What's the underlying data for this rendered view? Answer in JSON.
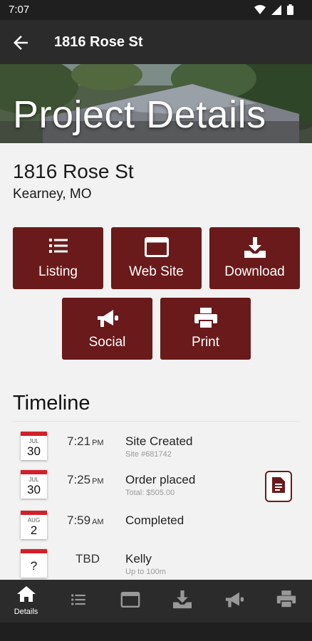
{
  "status_bar": {
    "time": "7:07"
  },
  "app_bar": {
    "title": "1816 Rose St",
    "back_icon": "arrow-back-icon"
  },
  "hero": {
    "title": "Project Details"
  },
  "address": {
    "street": "1816 Rose St",
    "city_state": "Kearney, MO"
  },
  "actions": [
    {
      "label": "Listing",
      "icon": "list-icon"
    },
    {
      "label": "Web Site",
      "icon": "browser-window-icon"
    },
    {
      "label": "Download",
      "icon": "download-icon"
    },
    {
      "label": "Social",
      "icon": "megaphone-icon"
    },
    {
      "label": "Print",
      "icon": "printer-icon"
    }
  ],
  "timeline": {
    "title": "Timeline",
    "events": [
      {
        "month": "JUL",
        "day": "30",
        "time": "7:21",
        "ampm": "PM",
        "event": "Site Created",
        "sub": "Site #681742"
      },
      {
        "month": "JUL",
        "day": "30",
        "time": "7:25",
        "ampm": "PM",
        "event": "Order placed",
        "sub": "Total: $505.00",
        "has_doc": true
      },
      {
        "month": "AUG",
        "day": "2",
        "time": "7:59",
        "ampm": "AM",
        "event": "Completed",
        "sub": ""
      },
      {
        "month": "",
        "day": "?",
        "time": "TBD",
        "ampm": "",
        "event": "Kelly",
        "sub": "Up to 100m"
      }
    ]
  },
  "bottom_nav": [
    {
      "label": "Details",
      "icon": "home-icon",
      "active": true
    },
    {
      "label": "",
      "icon": "list-icon"
    },
    {
      "label": "",
      "icon": "browser-window-icon"
    },
    {
      "label": "",
      "icon": "download-icon"
    },
    {
      "label": "",
      "icon": "megaphone-icon"
    },
    {
      "label": "",
      "icon": "printer-icon"
    }
  ],
  "colors": {
    "accent": "#6a1a1a",
    "app_bar": "#2b2b2b",
    "calendar_red": "#d2202a",
    "background": "#f2f2f2"
  }
}
